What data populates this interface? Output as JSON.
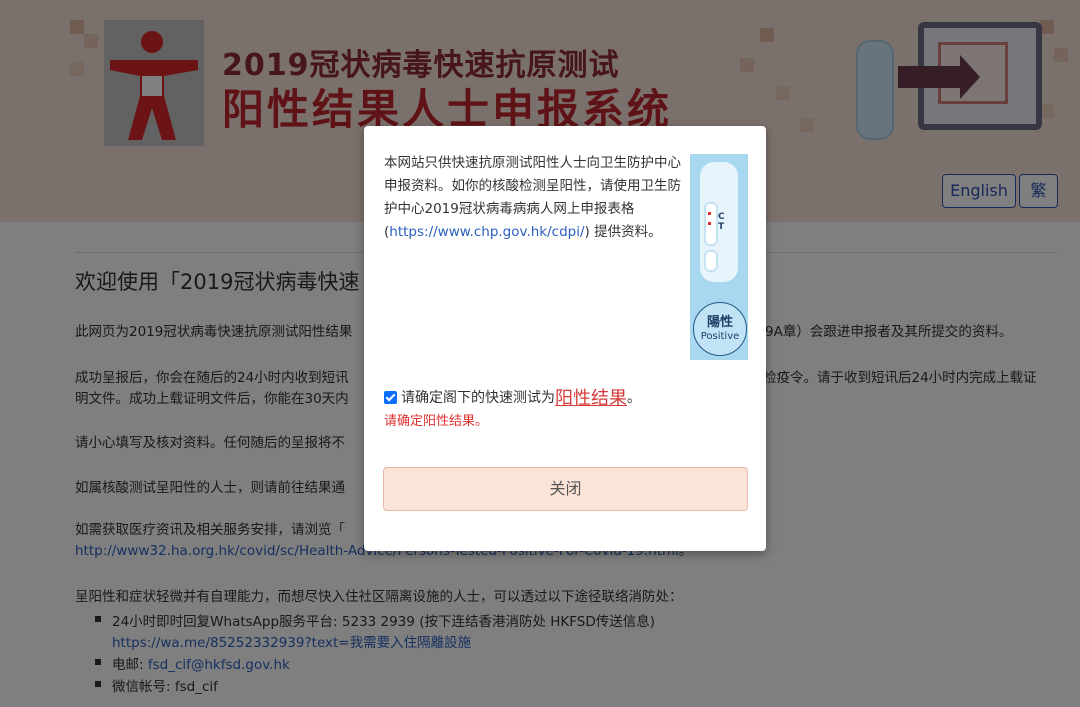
{
  "header": {
    "title_line1": "2019冠状病毒快速抗原测试",
    "title_line2": "阳性结果人士申报系统",
    "lang_english": "English",
    "lang_trad": "繁"
  },
  "main": {
    "heading": "欢迎使用「2019冠状病毒快速",
    "para1_pre": "此网页为2019冠状病毒快速抗原测试阳性结果",
    "para1_post": "9A章）会跟进申报者及其所提交的资料。",
    "para2_pre": "成功呈报后，你会在随后的24小时内收到短讯",
    "para2_post": "检疫令。请于收到短讯后24小时内完成上载证",
    "para2_line2": "明文件。成功上载证明文件后，你能在30天内",
    "para3": "请小心填写及核对资料。任何随后的呈报将不",
    "para4": "如属核酸测试呈阳性的人士，则请前往结果通",
    "para5": "如需获取医疗资讯及相关服务安排，请浏览「",
    "para5_link": "http://www32.ha.org.hk/covid/sc/Health-Advice/Persons-Tested-Positive-For-Covid-19.html",
    "para5_tail": "。",
    "para6": "呈阳性和症状轻微并有自理能力，而想尽快入住社区隔离设施的人士，可以透过以下途径联络消防处：",
    "list": [
      {
        "text": "24小时即时回复WhatsApp服务平台: 5233 2939 (按下连结香港消防处 HKFSD传送信息)",
        "link": "https://wa.me/85252332939?text=我需要入住隔離設施"
      },
      {
        "text": "电邮: ",
        "link": "fsd_cif@hkfsd.gov.hk"
      },
      {
        "text": "微信帐号: fsd_cif",
        "link": ""
      }
    ]
  },
  "modal": {
    "text_pre": "本网站只供快速抗原测试阳性人士向卫生防护中心申报资料。如你的核酸检测呈阳性，请使用卫生防护中心2019冠状病毒病病人网上申报表格 (",
    "text_link": "https://www.chp.gov.hk/cdpi/",
    "text_post": ") 提供资料。",
    "kit_ct": "C\nT",
    "badge_cn": "陽性",
    "badge_en": "Positive",
    "checkbox_pre": "请确定阁下的快速测试为",
    "checkbox_positive": "阳性结果",
    "checkbox_post": "。",
    "error_text": "请确定阳性结果。",
    "close_label": "关闭"
  }
}
